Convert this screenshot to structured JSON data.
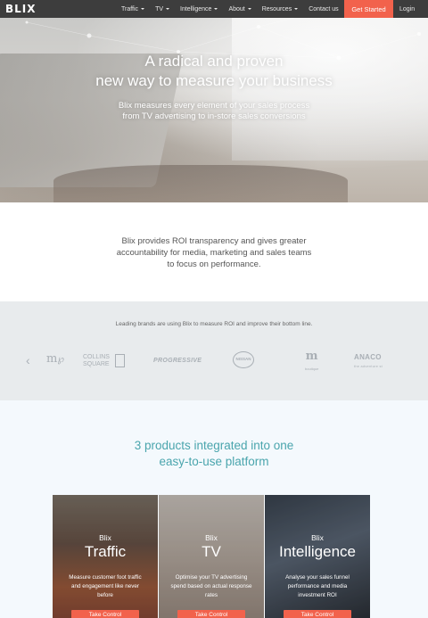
{
  "nav": {
    "logo": "BLIX",
    "items": [
      {
        "label": "Traffic",
        "dropdown": true
      },
      {
        "label": "TV",
        "dropdown": true
      },
      {
        "label": "Intelligence",
        "dropdown": true
      },
      {
        "label": "About",
        "dropdown": true
      },
      {
        "label": "Resources",
        "dropdown": true
      },
      {
        "label": "Contact us",
        "dropdown": false
      }
    ],
    "cta_label": "Get Started",
    "login_label": "Login"
  },
  "hero": {
    "headline_line1": "A radical and proven",
    "headline_line2": "new way to measure your business",
    "sub_line1": "Blix measures every element of your sales process",
    "sub_line2": "from TV advertising to in-store sales conversions"
  },
  "intro": {
    "line1": "Blix provides ROI transparency and gives greater",
    "line2": "accountability for media, marketing and sales teams",
    "line3": "to focus on performance."
  },
  "brands": {
    "lead": "Leading brands are using Blix to measure ROI and improve their bottom line.",
    "logos": [
      {
        "name": "m-logo",
        "text": "m"
      },
      {
        "name": "collins-square-logo",
        "line1": "COLLINS",
        "line2": "SQUARE"
      },
      {
        "name": "progressive-logo",
        "text": "PROGRESSIVE"
      },
      {
        "name": "nissan-logo",
        "text": "NISSAN"
      },
      {
        "name": "m-boutique-logo",
        "text": "m",
        "sub": "boutique"
      },
      {
        "name": "anaconda-logo",
        "text": "ANACO",
        "sub": "the adventure st"
      }
    ]
  },
  "colors": {
    "accent": "#f2624c",
    "teal": "#4aa5ad",
    "nav_bg": "#3d3d3d"
  },
  "products": {
    "heading_line1": "3 products integrated into one",
    "heading_line2": "easy-to-use platform",
    "cards": [
      {
        "pre": "Blix",
        "title": "Traffic",
        "desc_line1": "Measure customer foot traffic",
        "desc_line2": "and engagement like never",
        "desc_line3": "before",
        "button": "Take Control"
      },
      {
        "pre": "Blix",
        "title": "TV",
        "desc_line1": "Optimise your TV advertising",
        "desc_line2": "spend based on actual response",
        "desc_line3": "rates",
        "button": "Take Control"
      },
      {
        "pre": "Blix",
        "title": "Intelligence",
        "desc_line1": "Analyse your sales funnel",
        "desc_line2": "performance and media",
        "desc_line3": "investment ROI",
        "button": "Take Control"
      }
    ]
  }
}
